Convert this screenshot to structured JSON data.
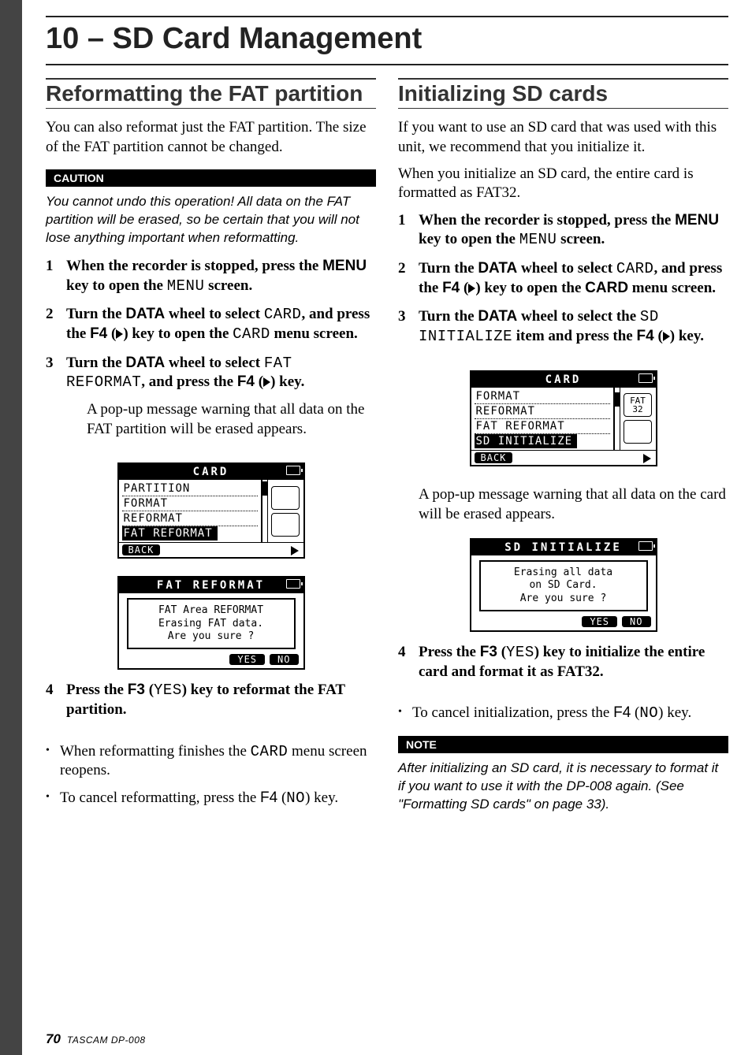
{
  "chapter_title": "10 – SD Card Management",
  "left": {
    "section_title": "Reformatting the FAT partition",
    "intro": "You can also reformat just the FAT partition. The size of the FAT partition cannot be changed.",
    "caution_label": "CAUTION",
    "caution_text": "You cannot undo this operation! All data on the FAT partition will be erased, so be certain that you will not lose anything important when reformatting.",
    "steps": {
      "s1a": "When the recorder is stopped, press the ",
      "s1b": "MENU",
      "s1c": " key to open the ",
      "s1d": "MENU",
      "s1e": " screen.",
      "s2a": "Turn the ",
      "s2b": "DATA",
      "s2c": " wheel to select ",
      "s2d": "CARD",
      "s2e": ", and press the ",
      "s2f": "F4",
      "s2g": " (",
      "s2h": ") key to open the ",
      "s2i": "CARD",
      "s2j": " menu screen.",
      "s3a": "Turn the ",
      "s3b": "DATA",
      "s3c": " wheel to select ",
      "s3d": "FAT REFORMAT",
      "s3e": ", and press the ",
      "s3f": "F4",
      "s3g": " (",
      "s3h": ") key."
    },
    "popup_note": "A pop-up message warning that all data on the FAT partition will be erased appears.",
    "shot1": {
      "header": "CARD",
      "items": [
        "PARTITION",
        "FORMAT",
        "REFORMAT",
        "FAT REFORMAT"
      ],
      "selected_index": 3,
      "footer_left": "BACK"
    },
    "shot2": {
      "header": "FAT REFORMAT",
      "dialog_l1": "FAT Area REFORMAT",
      "dialog_l2": "Erasing FAT data.",
      "dialog_l3": "Are you sure ?",
      "btn_yes": "YES",
      "btn_no": "NO"
    },
    "step4a": "Press the ",
    "step4b": "F3",
    "step4c": " (",
    "step4d": "YES",
    "step4e": ") key to reformat the FAT partition.",
    "bullets": {
      "b1a": "When reformatting finishes the ",
      "b1b": "CARD",
      "b1c": " menu screen reopens.",
      "b2a": "To cancel reformatting, press the ",
      "b2b": "F4",
      "b2c": " (",
      "b2d": "NO",
      "b2e": ") key."
    }
  },
  "right": {
    "section_title": "Initializing SD cards",
    "p1": "If you want to use an SD card that was used with this unit, we recommend that you initialize it.",
    "p2": "When you initialize an SD card, the entire card is formatted as FAT32.",
    "steps": {
      "s1a": "When the recorder is stopped, press the ",
      "s1b": "MENU",
      "s1c": " key to open the ",
      "s1d": "MENU",
      "s1e": " screen.",
      "s2a": "Turn the ",
      "s2b": "DATA",
      "s2c": " wheel to select ",
      "s2d": "CARD",
      "s2e": ", and press the ",
      "s2f": "F4",
      "s2g": " (",
      "s2h": ") key to open the ",
      "s2i": "CARD",
      "s2j": " menu screen.",
      "s3a": "Turn the ",
      "s3b": "DATA",
      "s3c": " wheel to select the ",
      "s3d": "SD INITIALIZE",
      "s3e": " item and press the ",
      "s3f": "F4",
      "s3g": " (",
      "s3h": ") key."
    },
    "shot1": {
      "header": "CARD",
      "items": [
        "FORMAT",
        "REFORMAT",
        "FAT REFORMAT",
        "SD INITIALIZE"
      ],
      "selected_index": 3,
      "footer_left": "BACK",
      "side_label": "FAT\n32"
    },
    "popup_note": "A pop-up message warning that all data on the card will be erased appears.",
    "shot2": {
      "header": "SD INITIALIZE",
      "dialog_l1": "Erasing all data",
      "dialog_l2": "on SD Card.",
      "dialog_l3": "Are you sure ?",
      "btn_yes": "YES",
      "btn_no": "NO"
    },
    "step4a": "Press the ",
    "step4b": "F3",
    "step4c": " (",
    "step4d": "YES",
    "step4e": ") key to initialize the entire card and format it as FAT32.",
    "bullets": {
      "b1a": "To cancel initialization, press the ",
      "b1b": "F4",
      "b1c": " (",
      "b1d": "NO",
      "b1e": ") key."
    },
    "note_label": "NOTE",
    "note_text": "After initializing an SD card, it is necessary to format it if you want to use it with the DP-008 again.  (See \"Formatting SD cards\" on page 33)."
  },
  "footer": {
    "page_number": "70",
    "product": "TASCAM DP-008"
  }
}
